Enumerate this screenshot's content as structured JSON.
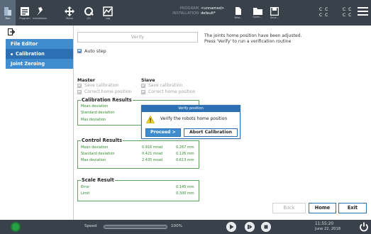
{
  "topbar": {
    "tabs": [
      {
        "label": "Run",
        "icon": "run-icon"
      },
      {
        "label": "Program",
        "icon": "program-icon"
      },
      {
        "label": "Installation",
        "icon": "installation-icon"
      },
      {
        "label": "Move",
        "icon": "move-icon"
      },
      {
        "label": "I/O",
        "icon": "io-icon"
      },
      {
        "label": "Log",
        "icon": "log-icon"
      }
    ],
    "program_key": "PROGRAM",
    "program_value": "<unnamed>",
    "installation_key": "INSTALLATION",
    "installation_value": "default*",
    "file_buttons": [
      {
        "label": "New...",
        "icon": "new-file-icon"
      },
      {
        "label": "Open...",
        "icon": "folder-icon"
      },
      {
        "label": "Save...",
        "icon": "save-icon"
      }
    ],
    "cc1": "C C\nC C",
    "cc2": "C C\nC C"
  },
  "sidebar": {
    "items": [
      {
        "label": "File Editor",
        "active": false
      },
      {
        "label": "Calibration",
        "active": true
      },
      {
        "label": "Joint Zeroing",
        "active": false
      }
    ]
  },
  "main": {
    "verify_label": "Verify",
    "info_line1": "The joints home position have been adjusted.",
    "info_line2": "Press 'Verify' to run a verification routine",
    "autostep_label": "Auto step",
    "autostep_checked": true,
    "master_title": "Master",
    "slave_title": "Slave",
    "save_calibration": "Save calibration",
    "correct_home": "Correct home position",
    "calibration_results": {
      "title": "Calibration Results",
      "rows": [
        "Mean deviation",
        "Standard deviation",
        "Max deviation"
      ]
    },
    "control_results": {
      "title": "Control Results",
      "rows": [
        {
          "label": "Mean deviation",
          "mrad": "0.916 mrad",
          "mm": "0.267 mm"
        },
        {
          "label": "Standard deviation",
          "mrad": "0.421 mrad",
          "mm": "0.126 mm"
        },
        {
          "label": "Max deviation",
          "mrad": "2.435 mrad",
          "mm": "0.613 mm"
        }
      ]
    },
    "scale_result": {
      "title": "Scale Result",
      "rows": [
        {
          "label": "Error",
          "mm": "0.145 mm"
        },
        {
          "label": "Limit",
          "mm": "0.300 mm"
        }
      ]
    }
  },
  "modal": {
    "title": "Verify position",
    "message": "Verify the robots home position",
    "proceed_label": "Proceed >",
    "abort_label": "Abort Calibration"
  },
  "buttons": {
    "back": "Back",
    "home": "Home",
    "exit": "Exit"
  },
  "footer": {
    "speed_label": "Speed",
    "speed_value": "100%",
    "speed_fraction": 1.0,
    "time": "11:55:20",
    "date": "June 22, 2018"
  },
  "colors": {
    "topbar_bg": "#39424b",
    "accent_blue": "#2d6fb3",
    "group_green": "#5aa55a",
    "power_green": "#27a047"
  }
}
